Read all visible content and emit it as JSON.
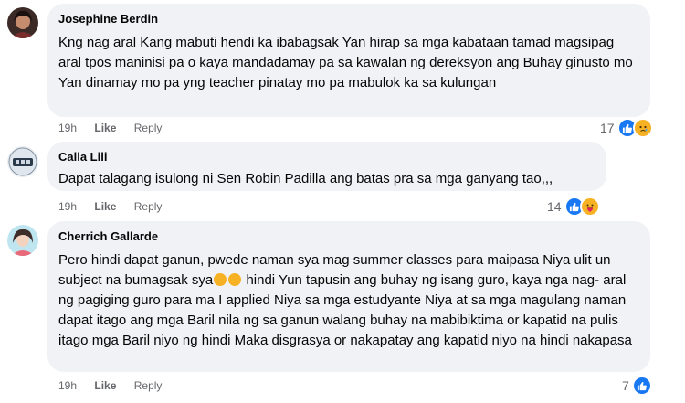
{
  "comments": [
    {
      "author": "Josephine Berdin",
      "text": "Kng nag aral Kang mabuti hendi ka ibabagsak Yan hirap sa mga kabataan tamad magsipag aral tpos maninisi pa o kaya mandadamay pa sa kawalan ng dereksyon ang Buhay ginusto mo Yan dinamay mo pa yng teacher pinatay mo pa mabulok ka sa kulungan",
      "time": "19h",
      "like": "Like",
      "reply": "Reply",
      "reaction_count": "17",
      "reaction_icons": [
        "like-icon",
        "sad-icon"
      ]
    },
    {
      "author": "Calla Lili",
      "text": "Dapat talagang isulong ni Sen Robin Padilla ang batas pra sa mga ganyang tao,,,",
      "time": "19h",
      "like": "Like",
      "reply": "Reply",
      "reaction_count": "14",
      "reaction_icons": [
        "like-icon",
        "care-icon"
      ]
    },
    {
      "author": "Cherrich Gallarde",
      "text_before": "Pero hindi dapat ganun, pwede naman sya mag summer classes para maipasa Niya ulit un subject na bumagsak sya",
      "text_after": "hindi Yun tapusin ang buhay ng isang guro, kaya nga nag- aral ng pagiging guro para ma I applied Niya sa mga estudyante Niya at sa mga magulang naman dapat itago ang mga Baril nila ng sa ganun walang buhay na mabibiktima or kapatid na pulis itago mga Baril niyo ng hindi Maka disgrasya or nakapatay ang kapatid niyo na hindi nakapasa",
      "inline_emojis": [
        "pensive-face-emoji",
        "pensive-face-emoji"
      ],
      "time": "19h",
      "like": "Like",
      "reply": "Reply",
      "reaction_count": "7",
      "reaction_icons": [
        "like-icon"
      ]
    }
  ],
  "colors": {
    "bubble": "#f0f2f5",
    "meta_text": "#65676b",
    "like_blue": "#1877f2",
    "emoji_yellow": "#f7b125"
  }
}
